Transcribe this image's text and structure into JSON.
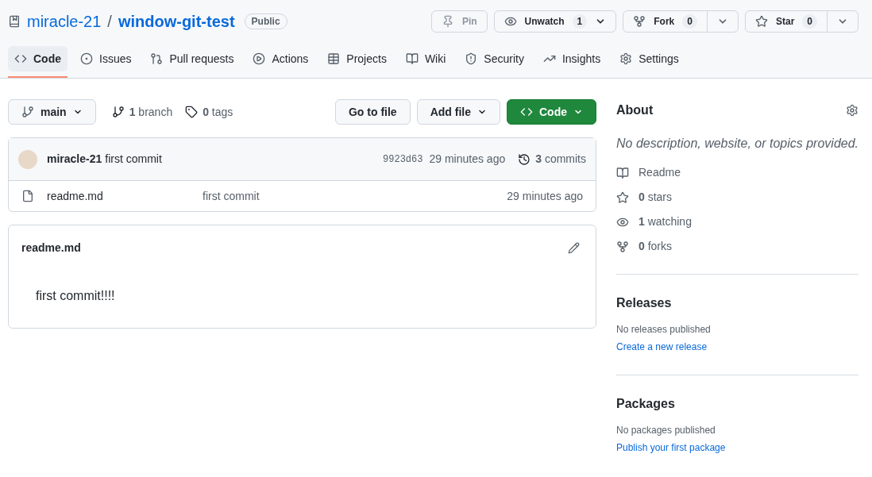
{
  "repo": {
    "owner": "miracle-21",
    "separator": "/",
    "name": "window-git-test",
    "visibility": "Public"
  },
  "actions": [
    {
      "label": "Pin",
      "disabled": true,
      "kind": "plain"
    },
    {
      "label": "Unwatch",
      "count": "1",
      "disabled": false,
      "kind": "caret"
    },
    {
      "label": "Fork",
      "count": "0",
      "disabled": false,
      "kind": "split"
    },
    {
      "label": "Star",
      "count": "0",
      "disabled": false,
      "kind": "split"
    }
  ],
  "tabs": [
    {
      "label": "Code",
      "selected": true
    },
    {
      "label": "Issues",
      "selected": false
    },
    {
      "label": "Pull requests",
      "selected": false
    },
    {
      "label": "Actions",
      "selected": false
    },
    {
      "label": "Projects",
      "selected": false
    },
    {
      "label": "Wiki",
      "selected": false
    },
    {
      "label": "Security",
      "selected": false
    },
    {
      "label": "Insights",
      "selected": false
    },
    {
      "label": "Settings",
      "selected": false
    }
  ],
  "toolbar": {
    "branch": "main",
    "branches": "**1** branch",
    "tags": "**0** tags",
    "buttons": [
      {
        "label": "Go to file",
        "kind": "plain"
      },
      {
        "label": "Add file",
        "kind": "menu"
      },
      {
        "label": "Code",
        "kind": "primary"
      }
    ]
  },
  "latest_commit": {
    "author": "miracle-21",
    "message": "first commit",
    "sha": "9923d63",
    "time": "29 minutes ago",
    "commits": "**3** commits"
  },
  "files": [
    {
      "name": "readme.md",
      "message": "first commit",
      "time": "29 minutes ago"
    }
  ],
  "readme": {
    "filename": "readme.md",
    "content": "first commit!!!!"
  },
  "about": {
    "title": "About",
    "description": "No description, website, or topics provided.",
    "items": [
      "Readme",
      "**0** stars",
      "**1** watching",
      "**0** forks"
    ]
  },
  "releases": {
    "title": "Releases",
    "note": "No releases published",
    "link": "Create a new release"
  },
  "packages": {
    "title": "Packages",
    "note": "No packages published",
    "link": "Publish your first package"
  }
}
